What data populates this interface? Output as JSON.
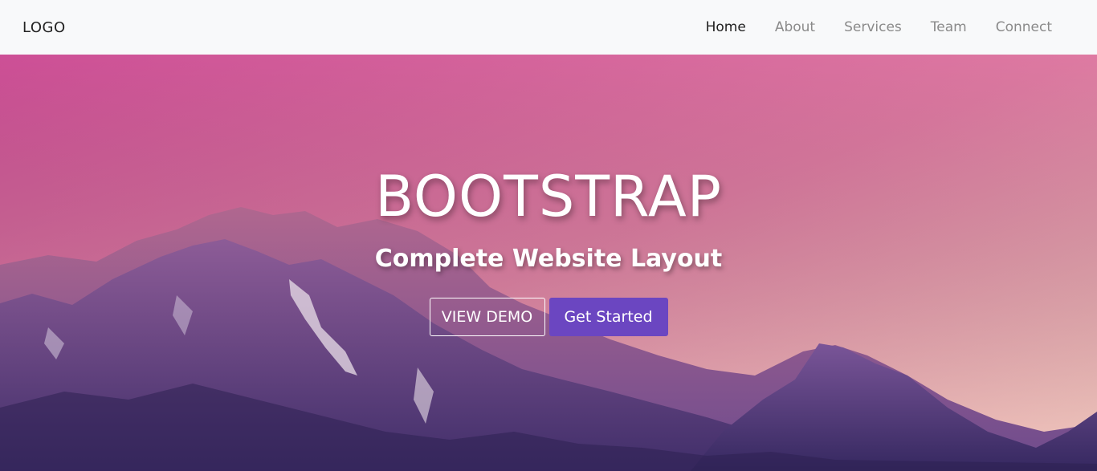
{
  "navbar": {
    "brand": "LOGO",
    "links": [
      {
        "label": "Home",
        "active": true
      },
      {
        "label": "About",
        "active": false
      },
      {
        "label": "Services",
        "active": false
      },
      {
        "label": "Team",
        "active": false
      },
      {
        "label": "Connect",
        "active": false
      }
    ]
  },
  "hero": {
    "title": "BOOTSTRAP",
    "subtitle": "Complete Website Layout",
    "buttons": {
      "view_demo": "VIEW DEMO",
      "get_started": "Get Started"
    },
    "background": "mountain-sunset-image"
  },
  "colors": {
    "nav_bg": "#f8f9fa",
    "nav_text": "#8a8a8a",
    "nav_active": "#222222",
    "accent": "#6b46c1",
    "sky_top": "#d1549a",
    "sky_bottom": "#f0b8b4",
    "mountain": "#5b3f8f"
  }
}
